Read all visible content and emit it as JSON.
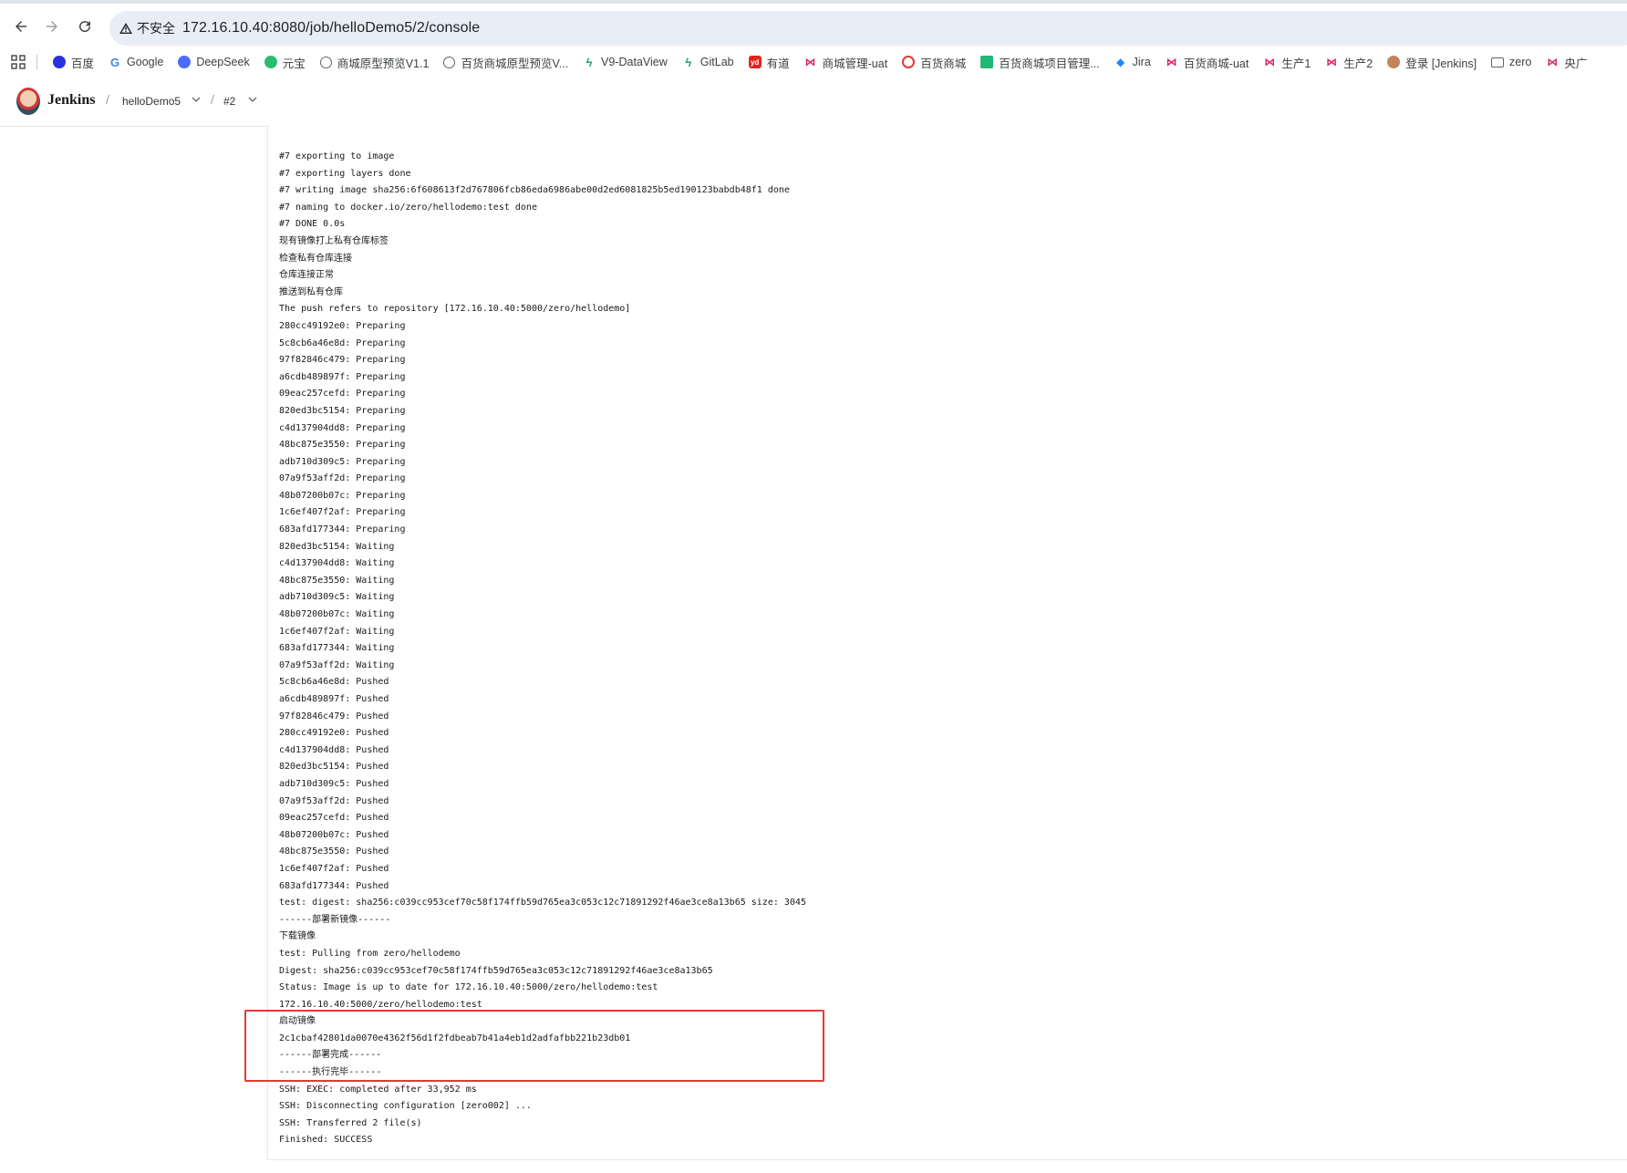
{
  "browser": {
    "security_label": "不安全",
    "url": "172.16.10.40:8080/job/helloDemo5/2/console"
  },
  "bookmarks": [
    {
      "label": "百度",
      "icon": "baidu-icon"
    },
    {
      "label": "Google",
      "icon": "google-icon"
    },
    {
      "label": "DeepSeek",
      "icon": "deepseek-icon"
    },
    {
      "label": "元宝",
      "icon": "yuanbao-icon"
    },
    {
      "label": "商城原型预览V1.1",
      "icon": "globe-icon"
    },
    {
      "label": "百货商城原型预览V...",
      "icon": "globe-icon"
    },
    {
      "label": "V9-DataView",
      "icon": "bolt-icon"
    },
    {
      "label": "GitLab",
      "icon": "bolt-icon"
    },
    {
      "label": "有道",
      "icon": "youdao-icon"
    },
    {
      "label": "商城管理-uat",
      "icon": "bow-icon"
    },
    {
      "label": "百货商城",
      "icon": "huo-icon"
    },
    {
      "label": "百货商城项目管理...",
      "icon": "grid-icon"
    },
    {
      "label": "Jira",
      "icon": "jira-icon"
    },
    {
      "label": "百货商城-uat",
      "icon": "bow-icon"
    },
    {
      "label": "生产1",
      "icon": "bow-icon"
    },
    {
      "label": "生产2",
      "icon": "bow-icon"
    },
    {
      "label": "登录 [Jenkins]",
      "icon": "user-icon"
    },
    {
      "label": "zero",
      "icon": "folder-icon"
    },
    {
      "label": "央广",
      "icon": "bow-icon"
    }
  ],
  "jenkins": {
    "title": "Jenkins",
    "breadcrumb": [
      "helloDemo5",
      "#2"
    ]
  },
  "console_lines": [
    "#7 exporting to image",
    "#7 exporting layers done",
    "#7 writing image sha256:6f608613f2d767806fcb86eda6986abe00d2ed6081825b5ed190123babdb48f1 done",
    "#7 naming to docker.io/zero/hellodemo:test done",
    "#7 DONE 0.0s",
    "现有镜像打上私有仓库标签",
    "检查私有仓库连接",
    "仓库连接正常",
    "推送到私有仓库",
    "The push refers to repository [172.16.10.40:5000/zero/hellodemo]",
    "280cc49192e0: Preparing",
    "5c8cb6a46e8d: Preparing",
    "97f82846c479: Preparing",
    "a6cdb489897f: Preparing",
    "09eac257cefd: Preparing",
    "820ed3bc5154: Preparing",
    "c4d137904dd8: Preparing",
    "48bc875e3550: Preparing",
    "adb710d309c5: Preparing",
    "07a9f53aff2d: Preparing",
    "48b07200b07c: Preparing",
    "1c6ef407f2af: Preparing",
    "683afd177344: Preparing",
    "820ed3bc5154: Waiting",
    "c4d137904dd8: Waiting",
    "48bc875e3550: Waiting",
    "adb710d309c5: Waiting",
    "48b07200b07c: Waiting",
    "1c6ef407f2af: Waiting",
    "683afd177344: Waiting",
    "07a9f53aff2d: Waiting",
    "5c8cb6a46e8d: Pushed",
    "a6cdb489897f: Pushed",
    "97f82846c479: Pushed",
    "280cc49192e0: Pushed",
    "c4d137904dd8: Pushed",
    "820ed3bc5154: Pushed",
    "adb710d309c5: Pushed",
    "07a9f53aff2d: Pushed",
    "09eac257cefd: Pushed",
    "48b07200b07c: Pushed",
    "48bc875e3550: Pushed",
    "1c6ef407f2af: Pushed",
    "683afd177344: Pushed",
    "test: digest: sha256:c039cc953cef70c58f174ffb59d765ea3c053c12c71891292f46ae3ce8a13b65 size: 3045",
    "------部署新镜像------",
    "下载镜像",
    "test: Pulling from zero/hellodemo",
    "Digest: sha256:c039cc953cef70c58f174ffb59d765ea3c053c12c71891292f46ae3ce8a13b65",
    "Status: Image is up to date for 172.16.10.40:5000/zero/hellodemo:test",
    "172.16.10.40:5000/zero/hellodemo:test",
    "启动镜像",
    "2c1cbaf42801da0070e4362f56d1f2fdbeab7b41a4eb1d2adfafbb221b23db01",
    "------部署完成------",
    "------执行完毕------",
    "SSH: EXEC: completed after 33,952 ms",
    "SSH: Disconnecting configuration [zero002] ...",
    "SSH: Transferred 2 file(s)",
    "Finished: SUCCESS"
  ],
  "colors": {
    "highlight": "#e53935",
    "omnibox_bg": "#e9eef6"
  }
}
